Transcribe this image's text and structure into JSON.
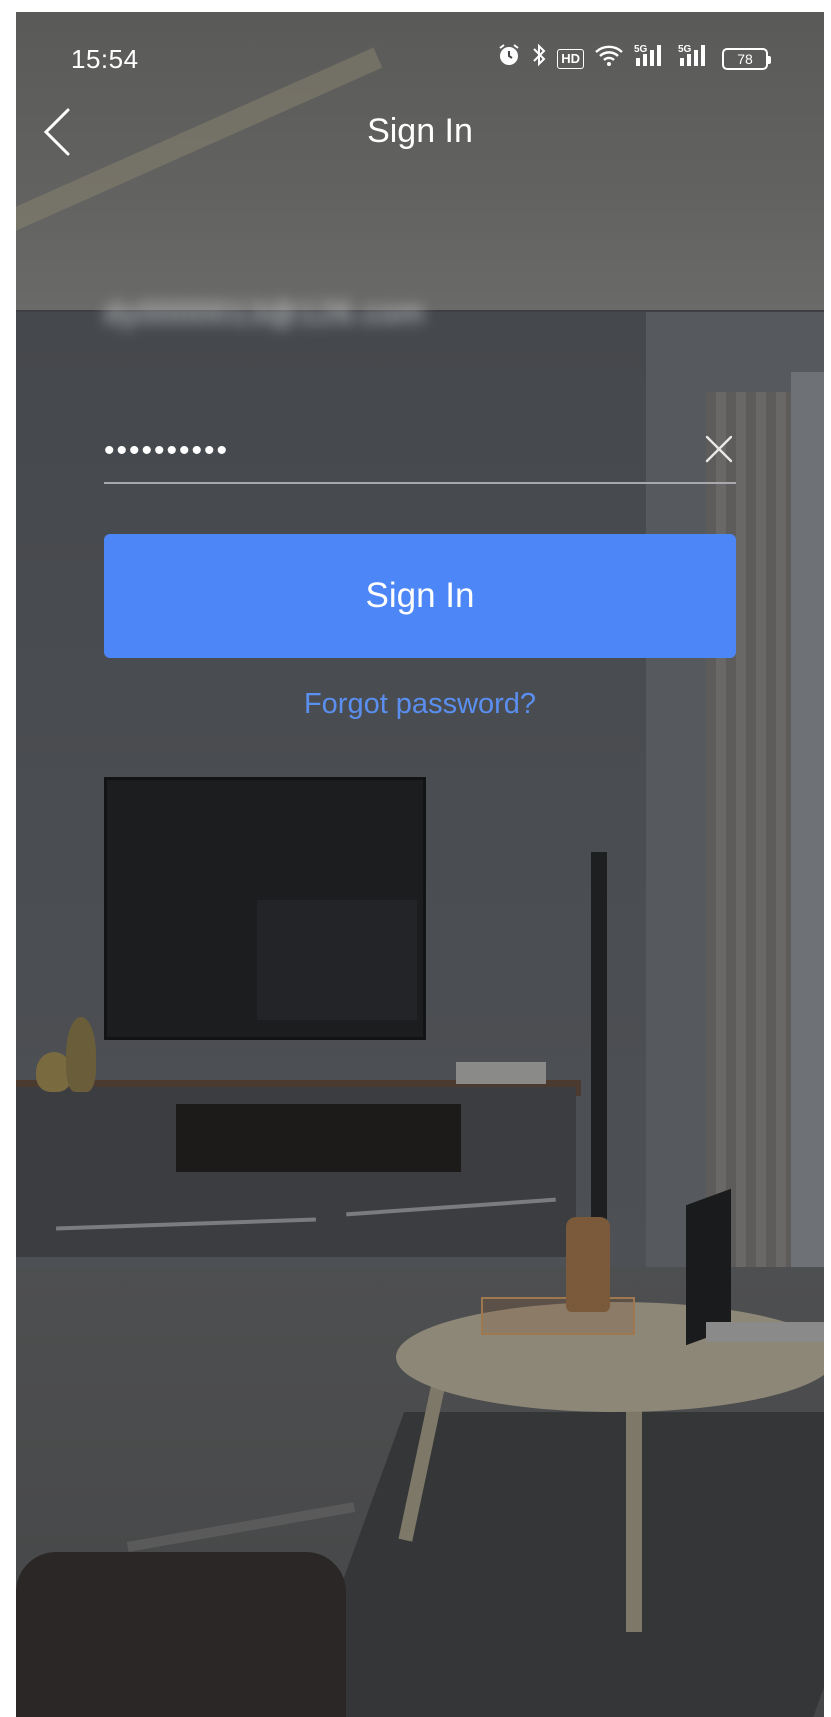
{
  "status_bar": {
    "time": "15:54",
    "icons": [
      "alarm-icon",
      "bluetooth-icon",
      "hd-icon",
      "wifi-icon",
      "signal-5g-icon",
      "signal-5g-icon",
      "battery-icon"
    ],
    "hd_label": "HD",
    "signal_label": "5G",
    "battery_level": "78"
  },
  "header": {
    "title": "Sign In",
    "back_icon": "chevron-left-icon"
  },
  "form": {
    "email_value": "dy0000013@126.com",
    "password_value": "••••••••••",
    "clear_icon": "close-icon",
    "signin_label": "Sign In",
    "forgot_label": "Forgot password?"
  },
  "colors": {
    "accent": "#4d86f7",
    "link": "#5a8ff0",
    "text": "#ffffff"
  }
}
